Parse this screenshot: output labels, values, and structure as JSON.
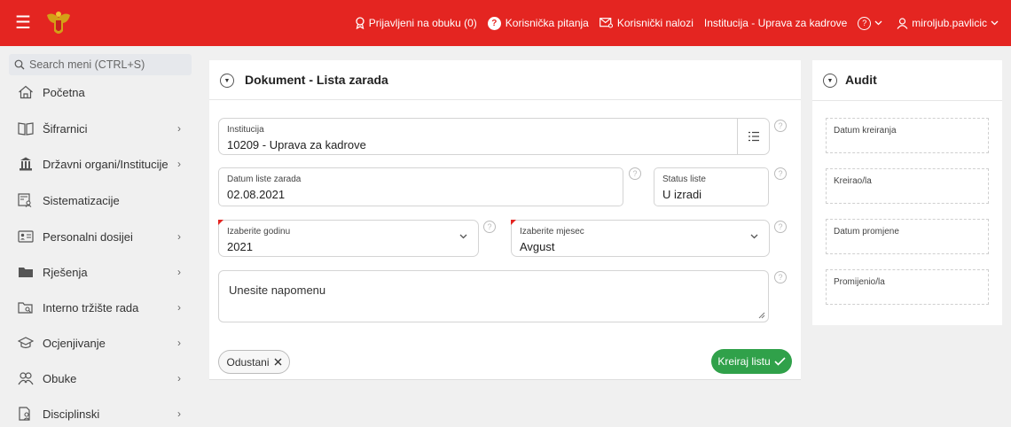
{
  "topbar": {
    "nav": [
      {
        "label": "Prijavljeni na obuku (0)",
        "icon": "award-icon"
      },
      {
        "label": "Korisnička pitanja",
        "icon": "question-circle-icon"
      },
      {
        "label": "Korisnički nalozi",
        "icon": "user-accounts-icon"
      },
      {
        "label": "Institucija - Uprava za kadrove",
        "icon": ""
      },
      {
        "label": "",
        "icon": "help-icon"
      },
      {
        "label": "miroljub.pavlicic",
        "icon": "user-icon"
      }
    ],
    "question_mark": "?",
    "help_mark": "?"
  },
  "sidebar": {
    "search_placeholder": "Search meni (CTRL+S)",
    "items": [
      {
        "label": "Početna",
        "icon": "home-icon",
        "has_children": false
      },
      {
        "label": "Šifrarnici",
        "icon": "book-icon",
        "has_children": true
      },
      {
        "label": "Državni organi/Institucije",
        "icon": "institution-icon",
        "has_children": true
      },
      {
        "label": "Sistematizacije",
        "icon": "org-chart-icon",
        "has_children": false
      },
      {
        "label": "Personalni dosijei",
        "icon": "id-card-icon",
        "has_children": true
      },
      {
        "label": "Rješenja",
        "icon": "folder-icon",
        "has_children": true
      },
      {
        "label": "Interno tržište rada",
        "icon": "search-folder-icon",
        "has_children": true
      },
      {
        "label": "Ocjenjivanje",
        "icon": "graduation-icon",
        "has_children": true
      },
      {
        "label": "Obuke",
        "icon": "users-icon",
        "has_children": true
      },
      {
        "label": "Disciplinski",
        "icon": "document-user-icon",
        "has_children": true
      }
    ],
    "chevron": "›"
  },
  "form": {
    "title": "Dokument - Lista zarada",
    "institucija": {
      "label": "Institucija",
      "value": "10209 - Uprava za kadrove"
    },
    "datum": {
      "label": "Datum liste zarada",
      "value": "02.08.2021"
    },
    "status": {
      "label": "Status liste",
      "value": "U izradi"
    },
    "godina": {
      "label": "Izaberite godinu",
      "value": "2021"
    },
    "mjesec": {
      "label": "Izaberite mjesec",
      "value": "Avgust"
    },
    "napomena": {
      "placeholder": "Unesite napomenu"
    },
    "cancel_label": "Odustani",
    "create_label": "Kreiraj listu",
    "help_mark": "?"
  },
  "audit": {
    "title": "Audit",
    "fields": [
      "Datum kreiranja",
      "Kreirao/la",
      "Datum promjene",
      "Promijenio/la"
    ]
  },
  "colors": {
    "brand_red": "#e42521",
    "success_green": "#30a14a"
  }
}
